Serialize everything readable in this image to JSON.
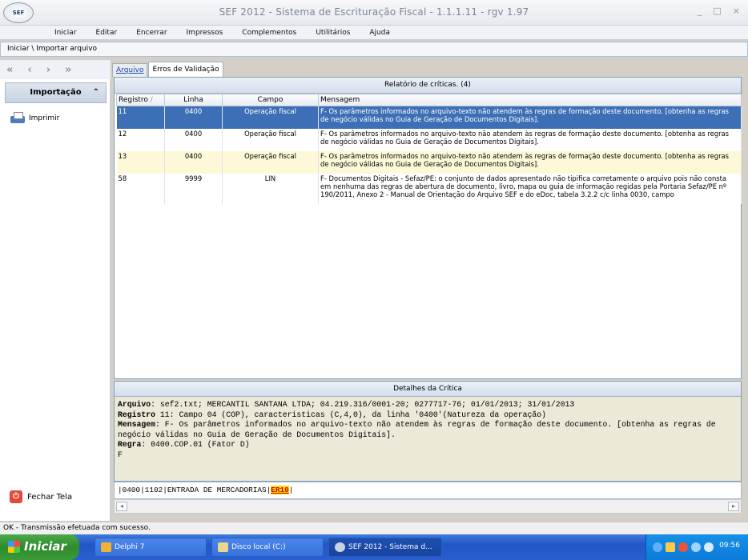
{
  "window": {
    "logo": "SEF",
    "title": "SEF 2012 - Sistema de Escrituração Fiscal - 1.1.1.11 - rgv 1.97",
    "controls": [
      "_",
      "□",
      "×"
    ]
  },
  "menu": [
    "Iniciar",
    "Editar",
    "Encerrar",
    "Impressos",
    "Complementos",
    "Utilitários",
    "Ajuda"
  ],
  "breadcrumb": "Iniciar \\ Importar arquivo",
  "nav": [
    "«",
    "‹",
    "›",
    "»"
  ],
  "sidebar": {
    "header": "Importação",
    "collapse": "⌃",
    "item": "Imprimir",
    "close_label": "Fechar Tela"
  },
  "tabs": [
    {
      "label": "Arquivo",
      "active": false
    },
    {
      "label": "Erros de Validação",
      "active": true
    }
  ],
  "report": {
    "title": "Relatório de críticas. (4)",
    "columns": [
      "Registro",
      "Linha",
      "Campo",
      "Mensagem"
    ],
    "sort_indicator": "/",
    "rows": [
      {
        "registro": "11",
        "linha": "0400",
        "campo": "Operação fiscal",
        "mensagem": "F- Os parâmetros informados no arquivo-texto não atendem às regras de formação deste documento. [obtenha as regras de negócio válidas no Guia de Geração de Documentos Digitais].",
        "style": "sel"
      },
      {
        "registro": "12",
        "linha": "0400",
        "campo": "Operação fiscal",
        "mensagem": "F- Os parâmetros informados no arquivo-texto não atendem às regras de formação deste documento. [obtenha as regras de negócio válidas no Guia de Geração de Documentos Digitais].",
        "style": "white"
      },
      {
        "registro": "13",
        "linha": "0400",
        "campo": "Operação fiscal",
        "mensagem": "F- Os parâmetros informados no arquivo-texto não atendem às regras de formação deste documento. [obtenha as regras de negócio válidas no Guia de Geração de Documentos Digitais].",
        "style": "yellow"
      },
      {
        "registro": "58",
        "linha": "9999",
        "campo": "LIN",
        "mensagem": "F- Documentos Digitais - Sefaz/PE: o conjunto de dados apresentado não tipifica corretamente o arquivo pois não consta em nenhuma das regras de abertura de documento, livro, mapa ou guia de informação regidas pela Portaria Sefaz/PE nº 190/2011, Anexo 2 - Manual de Orientação do Arquivo SEF e do eDoc, tabela 3.2.2 c/c linha 0030, campo",
        "style": "white"
      }
    ]
  },
  "details": {
    "title": "Detalhes da Crítica",
    "arquivo_label": "Arquivo",
    "arquivo_value": ": sef2.txt; MERCANTIL SANTANA LTDA; 04.219.316/0001-20; 0277717-76; 01/01/2013; 31/01/2013",
    "registro_label": "Registro",
    "registro_value": " 11: Campo 04 (COP), caracteristicas (C,4,0), da linha '0400'(Natureza da operação)",
    "mensagem_label": "Mensagem",
    "mensagem_value": ": F- Os parâmetros informados no arquivo-texto não atendem às regras de formação deste documento. [obtenha as regras de negócio válidas no Guia de Geração de Documentos Digitais].",
    "regra_label": "Regra",
    "regra_value": ": 0400.COP.01 (Fator D)",
    "fator": "F"
  },
  "rawline": {
    "prefix": "|0400|1102|ENTRADA DE MERCADORIAS|",
    "highlight": "ER10",
    "suffix": "|"
  },
  "status": "OK - Transmissão efetuada com sucesso.",
  "taskbar": {
    "start": "Iniciar",
    "tasks": [
      "Delphi 7",
      "Disco local (C:)",
      "SEF 2012 - Sistema d..."
    ],
    "clock": "09:56"
  }
}
